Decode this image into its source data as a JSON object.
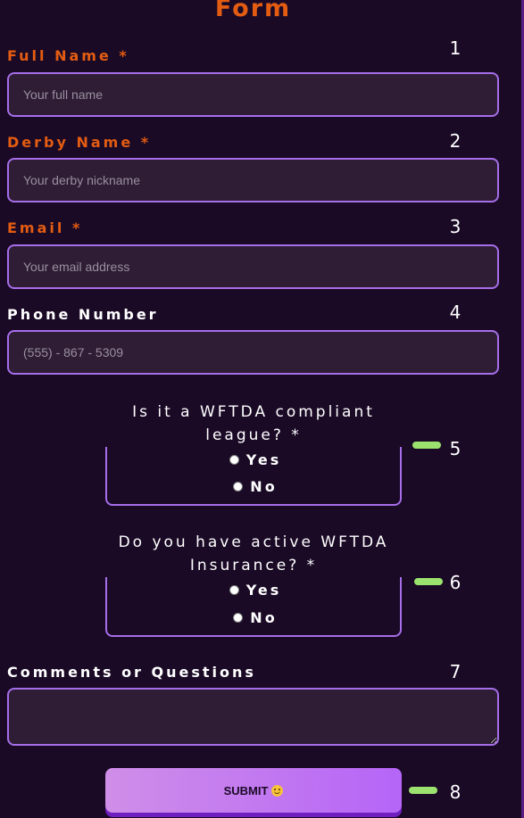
{
  "form": {
    "title": "Form"
  },
  "fields": {
    "full_name": {
      "label": "Full Name *",
      "placeholder": "Your full name",
      "number": "1"
    },
    "derby_name": {
      "label": "Derby Name *",
      "placeholder": "Your derby nickname",
      "number": "2"
    },
    "email": {
      "label": "Email *",
      "placeholder": "Your email address",
      "number": "3"
    },
    "phone": {
      "label": "Phone Number",
      "placeholder": "(555) - 867 - 5309",
      "number": "4"
    },
    "comments": {
      "label": "Comments or Questions",
      "number": "7"
    }
  },
  "questions": {
    "wftda_league": {
      "legend": "Is it a WFTDA compliant league? *",
      "yes_label": "Yes",
      "no_label": "No",
      "number": "5"
    },
    "wftda_insurance": {
      "legend": "Do you have active WFTDA Insurance? *",
      "yes_label": "Yes",
      "no_label": "No",
      "number": "6"
    }
  },
  "submit": {
    "label": "SUBMIT",
    "icon": "smiling-face-icon",
    "number": "8"
  },
  "colors": {
    "background": "#1a0a26",
    "accent_orange": "#e35c12",
    "border_purple": "#a66ee9",
    "input_bg": "#2e1d34",
    "marker_green": "#9be36e"
  }
}
